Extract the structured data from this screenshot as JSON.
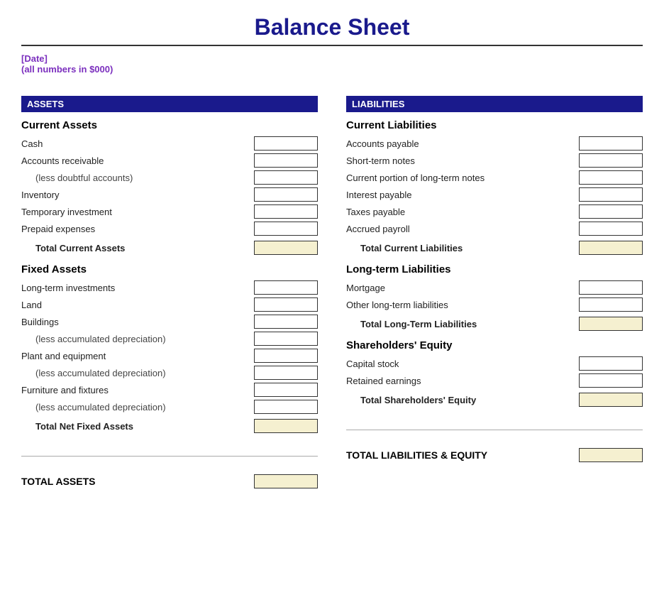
{
  "title": "Balance Sheet",
  "subtitle": {
    "date": "[Date]",
    "note": "(all numbers in $000)"
  },
  "left": {
    "header": "ASSETS",
    "current": {
      "title": "Current Assets",
      "rows": [
        {
          "label": "Cash",
          "indented": false
        },
        {
          "label": "Accounts receivable",
          "indented": false
        },
        {
          "label": "(less doubtful accounts)",
          "indented": true
        },
        {
          "label": "Inventory",
          "indented": false
        },
        {
          "label": "Temporary investment",
          "indented": false
        },
        {
          "label": "Prepaid expenses",
          "indented": false
        }
      ],
      "total_label": "Total Current Assets"
    },
    "fixed": {
      "title": "Fixed Assets",
      "rows": [
        {
          "label": "Long-term investments",
          "indented": false
        },
        {
          "label": "Land",
          "indented": false
        },
        {
          "label": "Buildings",
          "indented": false
        },
        {
          "label": "(less accumulated depreciation)",
          "indented": true
        },
        {
          "label": "Plant and equipment",
          "indented": false
        },
        {
          "label": "(less accumulated depreciation)",
          "indented": true
        },
        {
          "label": "Furniture and fixtures",
          "indented": false
        },
        {
          "label": "(less accumulated depreciation)",
          "indented": true
        }
      ],
      "total_label": "Total Net Fixed Assets"
    },
    "grand_total": "TOTAL ASSETS"
  },
  "right": {
    "header": "LIABILITIES",
    "current": {
      "title": "Current Liabilities",
      "rows": [
        {
          "label": "Accounts payable",
          "indented": false
        },
        {
          "label": "Short-term notes",
          "indented": false
        },
        {
          "label": "Current portion of long-term notes",
          "indented": false
        },
        {
          "label": "Interest payable",
          "indented": false
        },
        {
          "label": "Taxes payable",
          "indented": false
        },
        {
          "label": "Accrued payroll",
          "indented": false
        }
      ],
      "total_label": "Total Current Liabilities"
    },
    "longterm": {
      "title": "Long-term Liabilities",
      "rows": [
        {
          "label": "Mortgage",
          "indented": false
        },
        {
          "label": "Other long-term liabilities",
          "indented": false
        }
      ],
      "total_label": "Total Long-Term Liabilities"
    },
    "equity": {
      "title": "Shareholders' Equity",
      "rows": [
        {
          "label": "Capital stock",
          "indented": false
        },
        {
          "label": "Retained earnings",
          "indented": false
        }
      ],
      "total_label": "Total Shareholders' Equity"
    },
    "grand_total": "TOTAL LIABILITIES & EQUITY"
  }
}
